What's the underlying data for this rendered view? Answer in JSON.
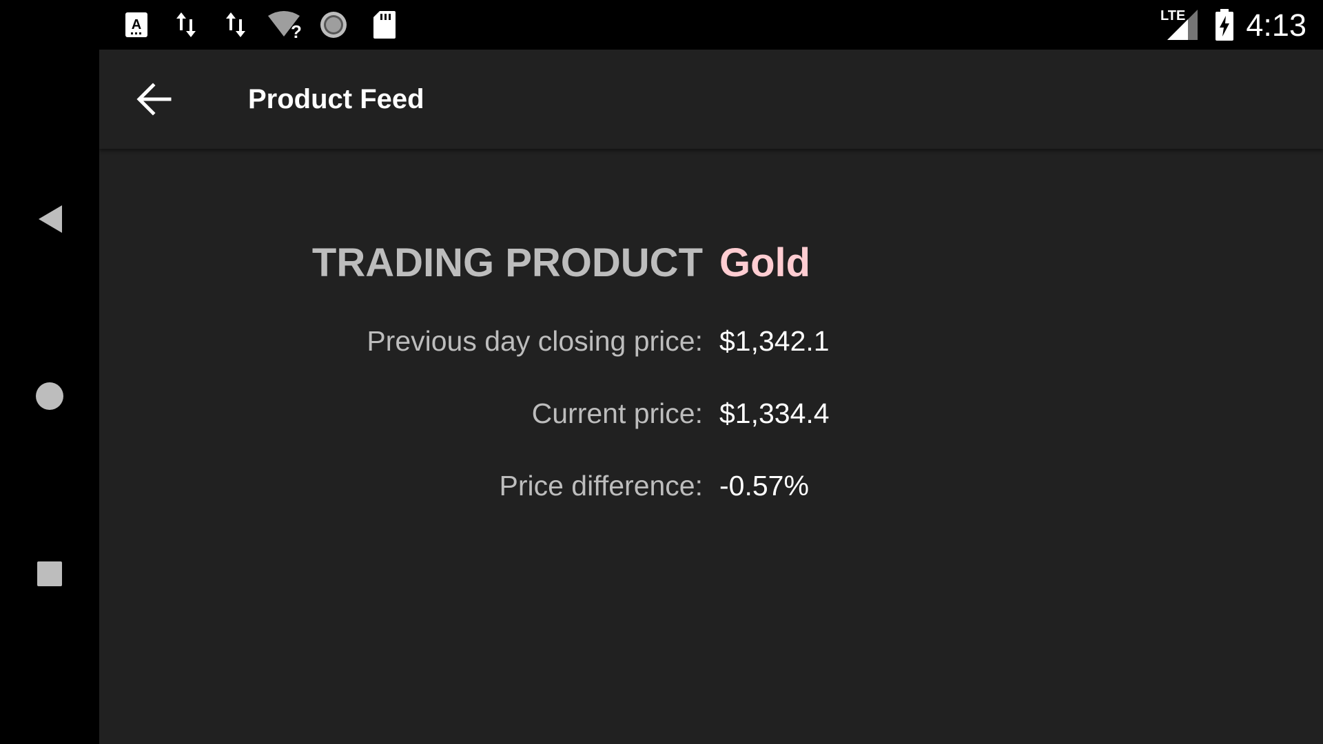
{
  "status_bar": {
    "icons": [
      "keyboard-icon",
      "data-transfer-icon",
      "data-transfer-icon",
      "wifi-unknown-icon",
      "sync-icon",
      "sd-card-icon"
    ],
    "network_label": "LTE",
    "time": "4:13"
  },
  "navigation": {
    "buttons": [
      "back-triangle-icon",
      "home-circle-icon",
      "recents-square-icon"
    ]
  },
  "toolbar": {
    "title": "Product Feed",
    "back_icon": "arrow-back-icon"
  },
  "product": {
    "heading_label": "TRADING PRODUCT",
    "name": "Gold",
    "rows": [
      {
        "label": "Previous day closing price:",
        "value": "$1,342.1"
      },
      {
        "label": "Current price:",
        "value": "$1,334.4"
      },
      {
        "label": "Price difference:",
        "value": "-0.57%"
      }
    ]
  },
  "colors": {
    "background": "#212121",
    "system_bars": "#000000",
    "accent": "#ffcdd2",
    "label_text": "#bdbdbd",
    "value_text": "#ffffff"
  }
}
